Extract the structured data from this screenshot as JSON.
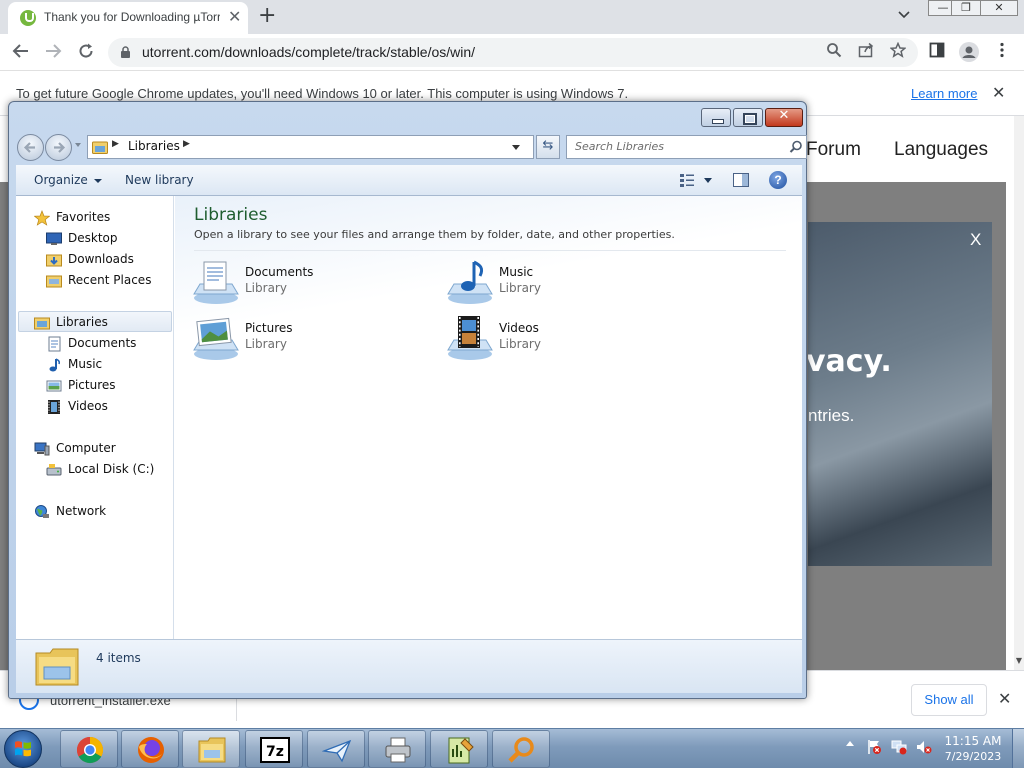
{
  "browser": {
    "tab_title": "Thank you for Downloading µTorrent",
    "tab_close": "✕",
    "new_tab": "+",
    "url": "utorrent.com/downloads/complete/track/stable/os/win/",
    "window_controls": [
      "—",
      "❐",
      "✕"
    ]
  },
  "infobar": {
    "message": "To get future Google Chrome updates, you'll need Windows 10 or later. This computer is using Windows 7.",
    "learn_more": "Learn more",
    "close": "✕"
  },
  "page": {
    "nav_forum": "Forum",
    "nav_languages": "Languages",
    "banner_close": "X",
    "banner_heading": "vacy.",
    "banner_sub": "ntries."
  },
  "downloads": {
    "file_name": "utorrent_installer.exe",
    "show_all": "Show all",
    "close": "✕"
  },
  "explorer": {
    "address": {
      "crumbs": [
        "Libraries"
      ]
    },
    "search_placeholder": "Search Libraries",
    "commands": {
      "organize": "Organize",
      "new_library": "New library",
      "help": "?"
    },
    "nav_pane": {
      "favorites": "Favorites",
      "desktop": "Desktop",
      "downloads": "Downloads",
      "recent_places": "Recent Places",
      "libraries": "Libraries",
      "documents": "Documents",
      "music": "Music",
      "pictures": "Pictures",
      "videos": "Videos",
      "computer": "Computer",
      "local_disk": "Local Disk (C:)",
      "network": "Network"
    },
    "content": {
      "title": "Libraries",
      "subtitle": "Open a library to see your files and arrange them by folder, date, and other properties.",
      "items": [
        {
          "name": "Documents",
          "type": "Library",
          "icon": "documents-library-icon"
        },
        {
          "name": "Music",
          "type": "Library",
          "icon": "music-library-icon"
        },
        {
          "name": "Pictures",
          "type": "Library",
          "icon": "pictures-library-icon"
        },
        {
          "name": "Videos",
          "type": "Library",
          "icon": "videos-library-icon"
        }
      ]
    },
    "details": {
      "count": "4 items"
    }
  },
  "taskbar": {
    "apps": [
      "chrome-icon",
      "firefox-icon",
      "explorer-icon",
      "7zip-icon",
      "paper-plane-icon",
      "printer-icon",
      "notepad-chart-icon",
      "search-magnifier-icon"
    ],
    "seven_zip_label": "7z",
    "clock": {
      "time": "11:15 AM",
      "date": "7/29/2023"
    }
  }
}
